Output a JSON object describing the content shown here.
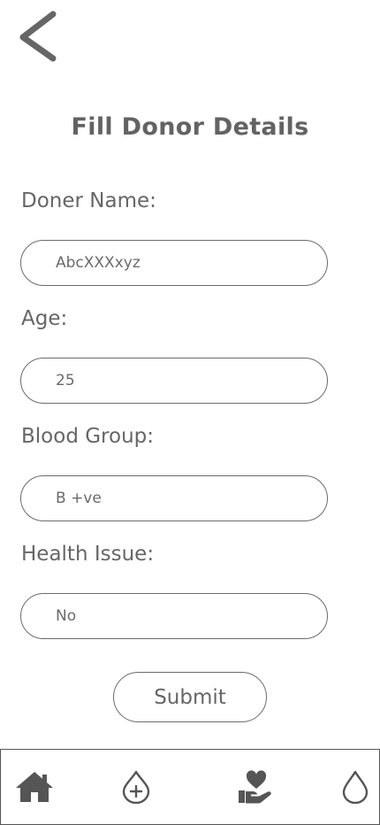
{
  "header": {
    "back_icon": "chevron-left-icon",
    "title": "Fill Donor Details"
  },
  "form": {
    "fields": [
      {
        "label": "Doner Name:",
        "value": "AbcXXXxyz"
      },
      {
        "label": "Age:",
        "value": "25"
      },
      {
        "label": "Blood Group:",
        "value": "B +ve"
      },
      {
        "label": "Health Issue:",
        "value": "No"
      }
    ],
    "submit_label": "Submit"
  },
  "bottom_nav": {
    "items": [
      {
        "icon": "home-icon"
      },
      {
        "icon": "add-blood-drop-icon"
      },
      {
        "icon": "donate-heart-hand-icon"
      },
      {
        "icon": "blood-drop-icon"
      }
    ]
  },
  "colors": {
    "text": "#666666",
    "border": "#6b6b6b",
    "icon": "#555555"
  }
}
